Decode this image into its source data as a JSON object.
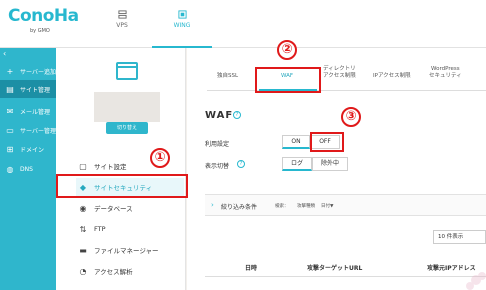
{
  "brand": {
    "logo": "ConoHa",
    "logo_sub": "by GMO"
  },
  "top_tabs": [
    {
      "label": "VPS"
    },
    {
      "label": "WING"
    }
  ],
  "sidebar": {
    "collapse": "‹",
    "items": [
      {
        "icon": "plus-icon",
        "glyph": "+",
        "label": "サーバー追加"
      },
      {
        "icon": "server-icon",
        "glyph": "▤",
        "label": "サイト管理"
      },
      {
        "icon": "mail-icon",
        "glyph": "✉",
        "label": "メール管理"
      },
      {
        "icon": "server-manage-icon",
        "glyph": "▭",
        "label": "サーバー管理"
      },
      {
        "icon": "domain-icon",
        "glyph": "⊞",
        "label": "ドメイン"
      },
      {
        "icon": "dns-icon",
        "glyph": "◍",
        "label": "DNS"
      }
    ]
  },
  "server_panel": {
    "button": "切り替え"
  },
  "site_menu": [
    {
      "icon": "site-settings-icon",
      "glyph": "▢",
      "label": "サイト設定"
    },
    {
      "icon": "shield-icon",
      "glyph": "◆",
      "label": "サイトセキュリティ"
    },
    {
      "icon": "database-icon",
      "glyph": "◉",
      "label": "データベース"
    },
    {
      "icon": "ftp-icon",
      "glyph": "⇅",
      "label": "FTP"
    },
    {
      "icon": "file-manager-icon",
      "glyph": "▬",
      "label": "ファイルマネージャー"
    },
    {
      "icon": "access-analysis-icon",
      "glyph": "◔",
      "label": "アクセス解析"
    }
  ],
  "sub_tabs": [
    {
      "label": "独自SSL"
    },
    {
      "label": "WAF"
    },
    {
      "label": "ディレクトリ\nアクセス制限"
    },
    {
      "label": "IPアクセス制限"
    },
    {
      "label": "WordPress\nセキュリティ"
    }
  ],
  "waf": {
    "title": "WAF",
    "setting_label": "利用設定",
    "on": "ON",
    "off": "OFF",
    "display_label": "表示切替",
    "log": "ログ",
    "exclude": "除外中"
  },
  "filter": {
    "label": "絞り込み条件",
    "items": [
      "検索：",
      "攻撃種類",
      "日付▼"
    ]
  },
  "pager": "10 件表示",
  "table_headers": [
    "日時",
    "攻撃ターゲットURL",
    "攻撃元IPアドレス"
  ],
  "annotations": [
    "①",
    "②",
    "③"
  ],
  "colors": {
    "accent": "#27b8cf",
    "annotation": "#e0191a"
  }
}
